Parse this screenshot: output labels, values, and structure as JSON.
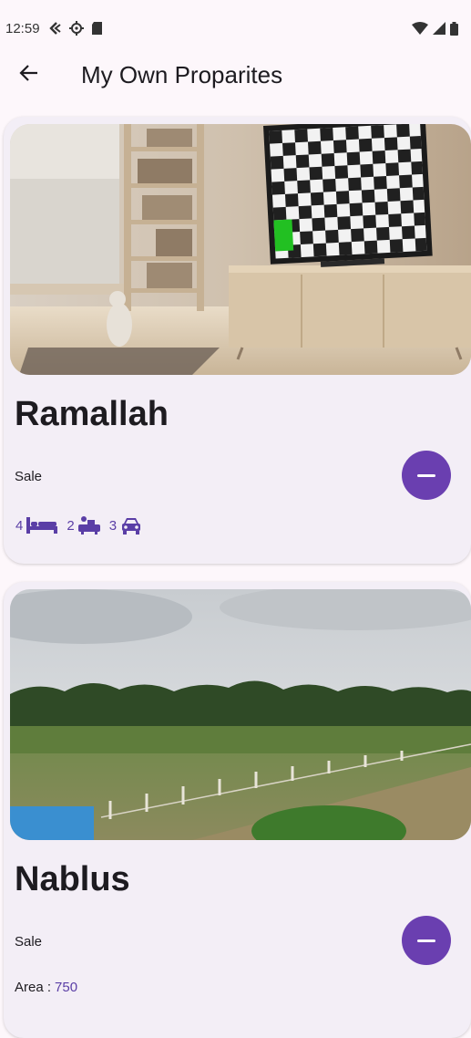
{
  "status_bar": {
    "time": "12:59",
    "icons_left": [
      "back-arrow-small-icon",
      "settings-icon",
      "sd-card-icon"
    ],
    "icons_right": [
      "wifi-icon",
      "signal-icon",
      "battery-icon"
    ]
  },
  "app_bar": {
    "back_icon": "arrow-left-icon",
    "title": "My Own Proparites"
  },
  "properties": [
    {
      "image": "living-room-photo",
      "city": "Ramallah",
      "type": "Sale",
      "beds": "4",
      "baths": "2",
      "garages": "3",
      "action_icon": "minus-icon"
    },
    {
      "image": "farmland-photo",
      "city": "Nablus",
      "type": "Sale",
      "area_label": "Area :",
      "area_value": "750",
      "action_icon": "minus-icon"
    }
  ],
  "colors": {
    "background": "#fdf7fb",
    "card": "#f3eef6",
    "accent": "#6a3fb0",
    "feature_text": "#5a3ea6"
  }
}
